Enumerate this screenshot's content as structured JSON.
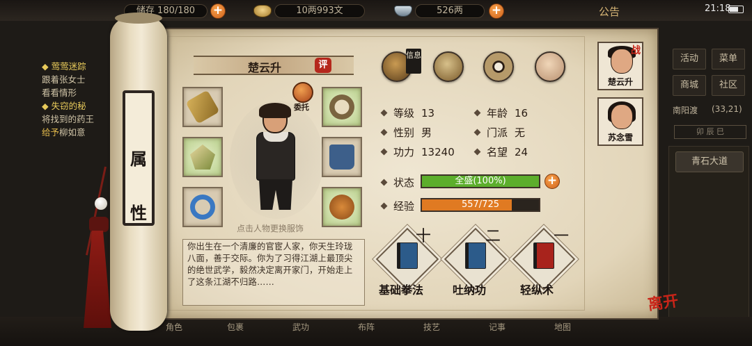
{
  "topbar": {
    "storage": "储存 180/180",
    "copper": "10两993文",
    "silver": "526两",
    "announcement": "公告",
    "time": "21:18"
  },
  "quests": {
    "q1_title": "莺莺迷踪",
    "q1_line1": "跟着张女士",
    "q1_line2": "看看情形",
    "q2_title": "失窃的秘",
    "q2_line1": "将找到的药王",
    "q2_line2_link": "给予",
    "q2_line2_rest": "柳如意"
  },
  "right_panel": {
    "buttons": [
      "活动",
      "菜单",
      "商城",
      "社区"
    ],
    "location": "南阳渡",
    "coords": "(33,21)",
    "time_tabs": "卯 辰 巳",
    "road": "青石大道"
  },
  "bottom_nav": [
    "角色",
    "包裹",
    "武功",
    "布阵",
    "技艺",
    "记事",
    "地图"
  ],
  "scroll": {
    "title": "属性",
    "title_char1": "属",
    "title_char2": "性"
  },
  "character": {
    "name": "楚云升",
    "rate_badge": "评",
    "delegate_label": "委托",
    "outfit_hint": "点击人物更换服饰",
    "bio": "你出生在一个清廉的官宦人家，你天生玲珑八面，善于交际。你为了习得江湖上最顶尖的绝世武学，毅然决定离开家门，开始走上了这条江湖不归路……"
  },
  "menu": {
    "info_tag": "信息",
    "icons": [
      "hat-info-icon",
      "scroll-book-icon",
      "bagua-icon",
      "muscle-figure-icon"
    ]
  },
  "stats": {
    "level_label": "等级",
    "level_value": "13",
    "age_label": "年龄",
    "age_value": "16",
    "gender_label": "性别",
    "gender_value": "男",
    "sect_label": "门派",
    "sect_value": "无",
    "power_label": "功力",
    "power_value": "13240",
    "fame_label": "名望",
    "fame_value": "24"
  },
  "status": {
    "label": "状态",
    "text": "全盛(100%)",
    "fraction": 1.0,
    "color": "#5cae2c"
  },
  "exp": {
    "label": "经验",
    "text": "557/725",
    "fraction": 0.768,
    "color": "#e07a22"
  },
  "skills": [
    {
      "name": "基础拳法",
      "rank": "十",
      "book_color": "#2c5b8a"
    },
    {
      "name": "吐纳功",
      "rank": "二",
      "book_color": "#2c5b8a"
    },
    {
      "name": "轻纵术",
      "rank": "一",
      "book_color": "#a8231c"
    }
  ],
  "party": [
    {
      "name": "楚云升",
      "tag": "战"
    },
    {
      "name": "苏念雪",
      "tag": ""
    }
  ],
  "leave_label": "离开"
}
